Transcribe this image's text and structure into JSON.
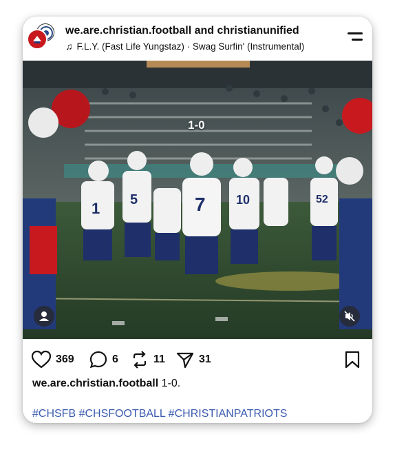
{
  "post": {
    "handles": "we.are.christian.football and christianunified",
    "audio": "F.L.Y. (Fast Life Yungstaz) · Swag Surfin' (Instrumental)",
    "score_overlay": "1-0",
    "actions": {
      "likes": "369",
      "comments": "6",
      "reposts": "11",
      "shares": "31"
    },
    "caption_user": "we.are.christian.football",
    "caption_text": "1-0.",
    "hashtags": "#CHSFB #CHSFOOTBALL #CHRISTIANPATRIOTS"
  },
  "icons": {
    "menu": "menu-icon",
    "music": "music-note-icon",
    "like": "heart-icon",
    "comment": "comment-icon",
    "repost": "repost-icon",
    "share": "send-icon",
    "save": "bookmark-icon",
    "mute": "muted-speaker-icon",
    "tag": "person-icon"
  },
  "colors": {
    "accent_red": "#c8191f",
    "hashtag_blue": "#3a5bb0",
    "text": "#111111"
  }
}
